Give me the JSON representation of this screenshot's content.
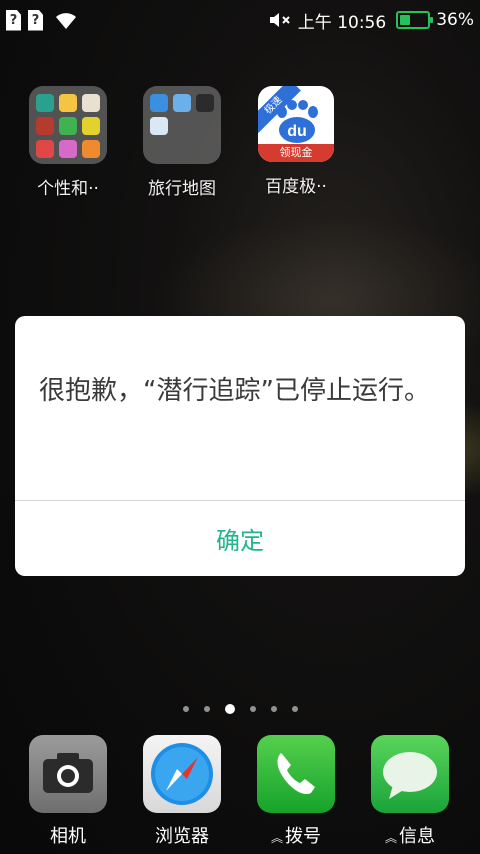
{
  "status": {
    "sim1": "?",
    "sim2": "?",
    "time": "上午 10:56",
    "battery_percent": "36%",
    "battery_level": 0.36,
    "accent_color": "#25c25c"
  },
  "home_apps": [
    {
      "label": "个性和··",
      "icon": "folder-icon"
    },
    {
      "label": "旅行地图",
      "icon": "folder-icon"
    },
    {
      "label": "百度极··",
      "icon": "baidu-icon"
    }
  ],
  "baidu_icon": {
    "badge": "极速",
    "strip": "领现金",
    "logo_text": "du"
  },
  "dialog": {
    "message": "很抱歉，“潜行追踪”已停止运行。",
    "ok_label": "确定",
    "ok_color": "#23b38e"
  },
  "page_indicator": {
    "count": 6,
    "active_index": 2
  },
  "dock": [
    {
      "label": "相机",
      "icon": "camera-icon"
    },
    {
      "label": "浏览器",
      "icon": "compass-icon"
    },
    {
      "label": "拨号",
      "icon": "phone-icon"
    },
    {
      "label": "信息",
      "icon": "message-bubble-icon"
    }
  ]
}
